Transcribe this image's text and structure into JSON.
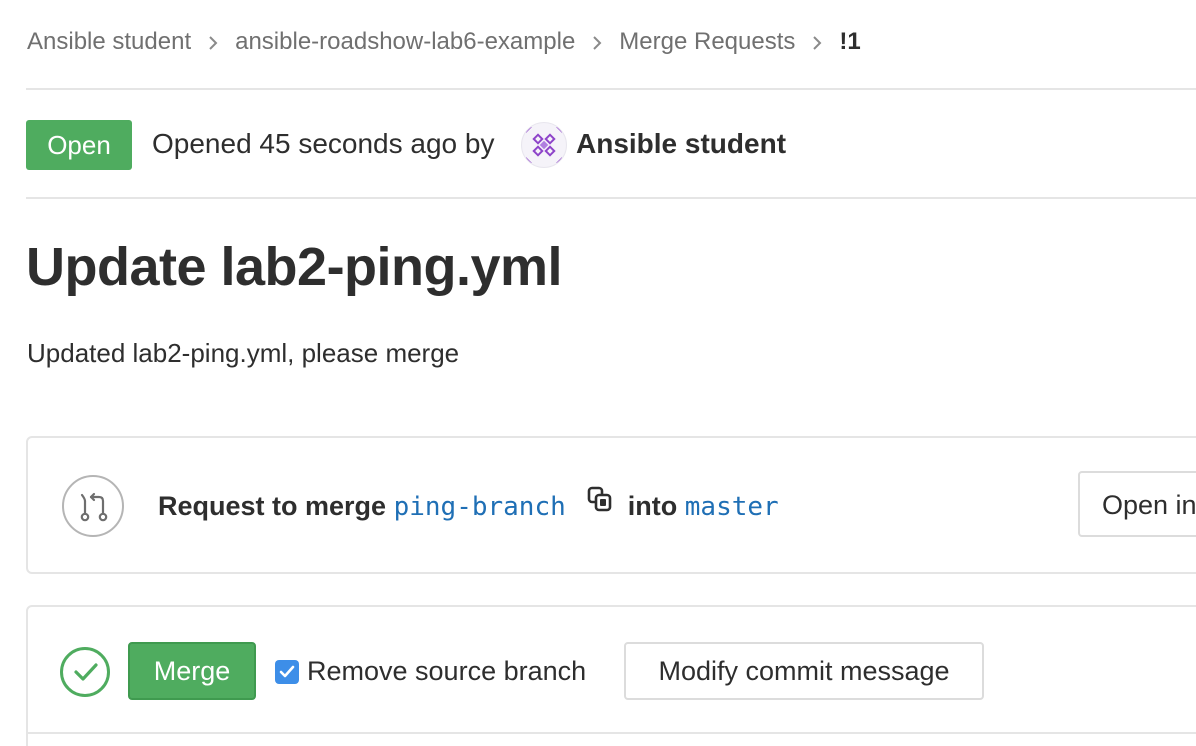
{
  "breadcrumb": {
    "items": [
      "Ansible student",
      "ansible-roadshow-lab6-example",
      "Merge Requests"
    ],
    "current": "!1"
  },
  "status": {
    "badge": "Open",
    "opened_text": "Opened 45 seconds ago by",
    "author": "Ansible student",
    "badge_color": "#4fac5f"
  },
  "merge_request": {
    "title": "Update lab2-ping.yml",
    "description": "Updated lab2-ping.yml, please merge"
  },
  "branch_info": {
    "prefix": "Request to merge",
    "source_branch": "ping-branch",
    "connector": "into",
    "target_branch": "master",
    "open_in_label": "Open in"
  },
  "merge_widget": {
    "merge_label": "Merge",
    "remove_source_branch_label": "Remove source branch",
    "remove_source_branch_checked": true,
    "modify_commit_label": "Modify commit message"
  },
  "icons": {
    "merge_request": "merge-request-icon",
    "copy": "copy-icon",
    "status_ok": "check-circle-icon",
    "avatar": "identicon-avatar"
  },
  "colors": {
    "success": "#4fac5f",
    "link": "#1f6fb5",
    "checkbox": "#3d8ee8"
  }
}
